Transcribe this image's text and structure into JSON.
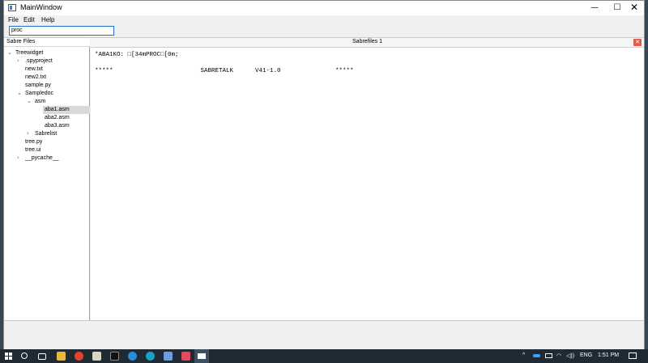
{
  "window": {
    "title": "MainWindow",
    "controls": {
      "minimize": "—",
      "maximize": "☐",
      "close": "✕"
    }
  },
  "menu": {
    "file": "File",
    "edit": "Edit",
    "help": "Help"
  },
  "search": {
    "value": "proc"
  },
  "tree": {
    "header": "Sabre Files",
    "items": [
      {
        "label": "Treewidget",
        "chevron": "v"
      },
      {
        "label": ".spyproject",
        "chevron": ">"
      },
      {
        "label": "new.txt"
      },
      {
        "label": "new2.txt"
      },
      {
        "label": "sample.py"
      },
      {
        "label": "Sampledoc",
        "chevron": "v"
      },
      {
        "label": "asm",
        "chevron": "v"
      },
      {
        "label": "aba1.asm",
        "selected": true
      },
      {
        "label": "aba2.asm"
      },
      {
        "label": "aba3.asm"
      },
      {
        "label": "Sabrelist",
        "chevron": ">"
      },
      {
        "label": "tree.py"
      },
      {
        "label": "tree.ui"
      },
      {
        "label": "__pycache__",
        "chevron": ">"
      }
    ]
  },
  "editor": {
    "tab_title": "Sabrefiles 1",
    "tab_close": "✕",
    "lines": [
      "*ABA1KO: □[34mPROC□[0m;",
      "*****                        SABRETALK      V41-1.0               *****"
    ]
  },
  "taskbar": {
    "tray": {
      "language": "ENG",
      "time": "1:51 PM"
    }
  },
  "colors": {
    "accent": "#1f6fd1",
    "tab_close": "#e35b4b",
    "taskbar": "#1f2a33"
  }
}
